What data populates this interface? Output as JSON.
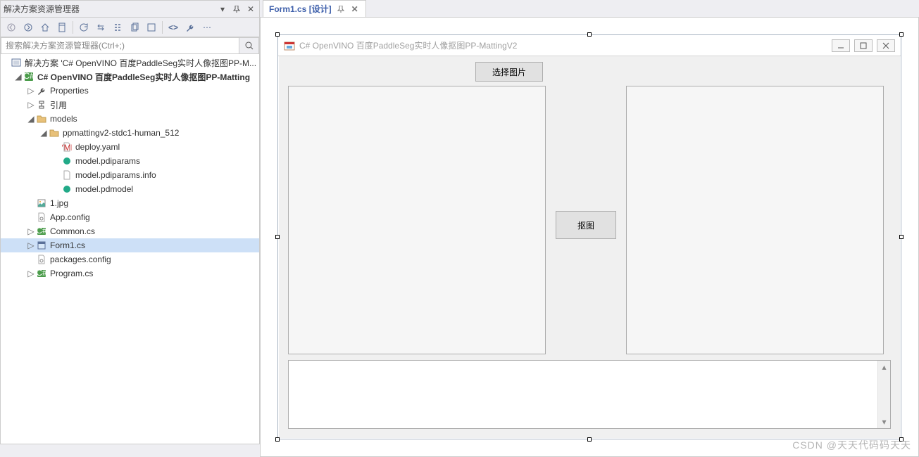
{
  "solution_explorer": {
    "title": "解决方案资源管理器",
    "search_placeholder": "搜索解决方案资源管理器(Ctrl+;)",
    "solution_label": "解决方案 'C# OpenVINO 百度PaddleSeg实时人像抠图PP-M...",
    "project_label": "C# OpenVINO 百度PaddleSeg实时人像抠图PP-Matting",
    "nodes": {
      "properties": "Properties",
      "references": "引用",
      "models": "models",
      "model_folder": "ppmattingv2-stdc1-human_512",
      "deploy_yaml": "deploy.yaml",
      "model_pdiparams": "model.pdiparams",
      "model_pdiparams_info": "model.pdiparams.info",
      "model_pdmodel": "model.pdmodel",
      "img_1jpg": "1.jpg",
      "app_config": "App.config",
      "common_cs": "Common.cs",
      "form1_cs": "Form1.cs",
      "packages_config": "packages.config",
      "program_cs": "Program.cs"
    }
  },
  "tab": {
    "label": "Form1.cs [设计]"
  },
  "form": {
    "title": "C# OpenVINO 百度PaddleSeg实时人像抠图PP-MattingV2",
    "btn_select": "选择图片",
    "btn_matting": "抠图"
  },
  "watermark": "CSDN @天天代码码天天"
}
